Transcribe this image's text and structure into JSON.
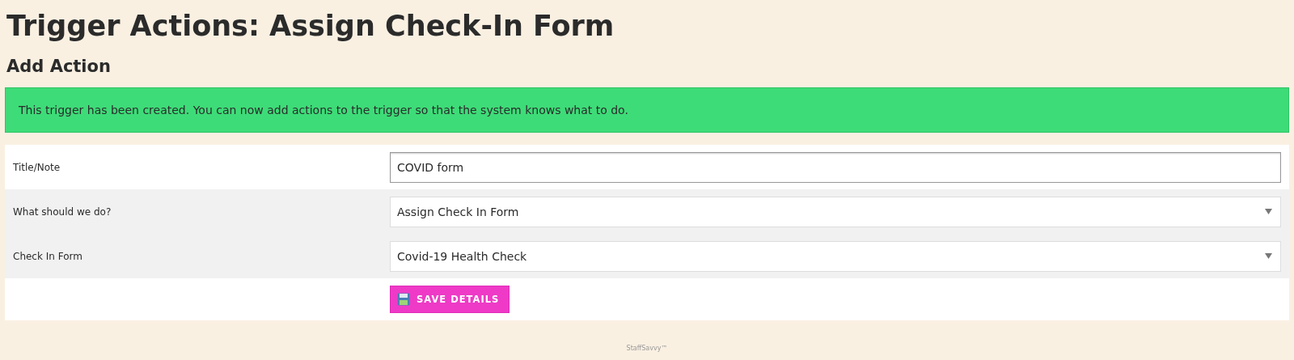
{
  "page_title": "Trigger Actions: Assign Check-In Form",
  "section_title": "Add Action",
  "alert": {
    "text": "This trigger has been created. You can now add actions to the trigger so that the system knows what to do."
  },
  "form": {
    "rows": [
      {
        "kind": "text",
        "label": "Title/Note",
        "value": "COVID form"
      },
      {
        "kind": "select",
        "label": "What should we do?",
        "value": "Assign Check In Form"
      },
      {
        "kind": "select",
        "label": "Check In Form",
        "value": "Covid-19 Health Check"
      }
    ],
    "save_button": "SAVE DETAILS"
  },
  "footer": "StaffSavvy™"
}
